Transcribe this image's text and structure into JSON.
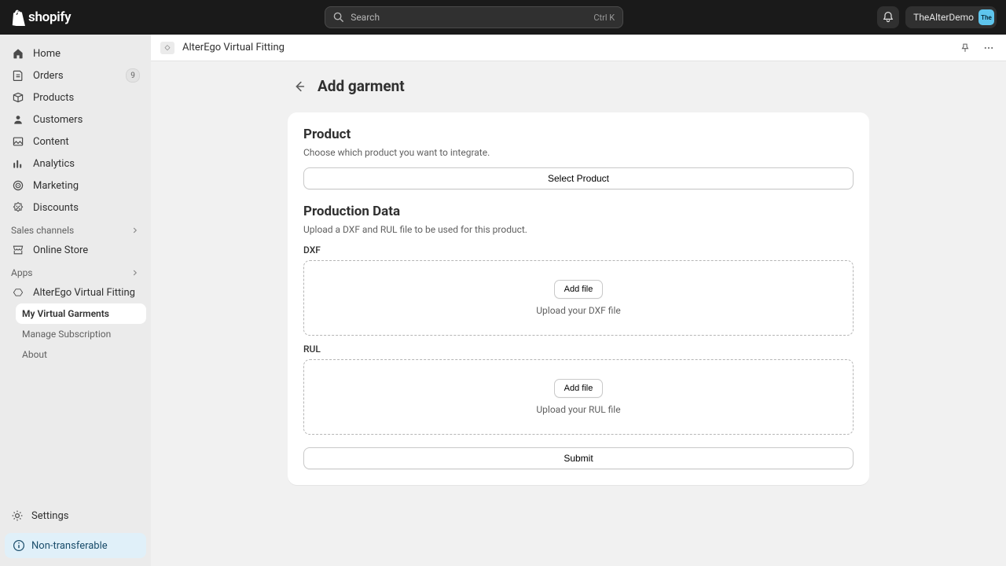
{
  "topbar": {
    "search_placeholder": "Search",
    "search_shortcut": "Ctrl K",
    "username": "TheAlterDemo",
    "avatar_initials": "The"
  },
  "sidebar": {
    "items": [
      {
        "label": "Home"
      },
      {
        "label": "Orders",
        "badge": "9"
      },
      {
        "label": "Products"
      },
      {
        "label": "Customers"
      },
      {
        "label": "Content"
      },
      {
        "label": "Analytics"
      },
      {
        "label": "Marketing"
      },
      {
        "label": "Discounts"
      }
    ],
    "sales_channels_header": "Sales channels",
    "online_store_label": "Online Store",
    "apps_header": "Apps",
    "app_name": "AlterEgo Virtual Fitting",
    "app_subitems": [
      {
        "label": "My Virtual Garments",
        "selected": true
      },
      {
        "label": "Manage Subscription"
      },
      {
        "label": "About"
      }
    ],
    "settings_label": "Settings",
    "info_pill": "Non-transferable"
  },
  "app_header": {
    "name": "AlterEgo Virtual Fitting"
  },
  "page": {
    "title": "Add garment",
    "product": {
      "heading": "Product",
      "desc": "Choose which product you want to integrate.",
      "select_button": "Select Product"
    },
    "production": {
      "heading": "Production Data",
      "desc": "Upload a DXF and RUL file to be used for this product.",
      "dxf_label": "DXF",
      "dxf_add": "Add file",
      "dxf_hint": "Upload your DXF file",
      "rul_label": "RUL",
      "rul_add": "Add file",
      "rul_hint": "Upload your RUL file",
      "submit": "Submit"
    }
  }
}
